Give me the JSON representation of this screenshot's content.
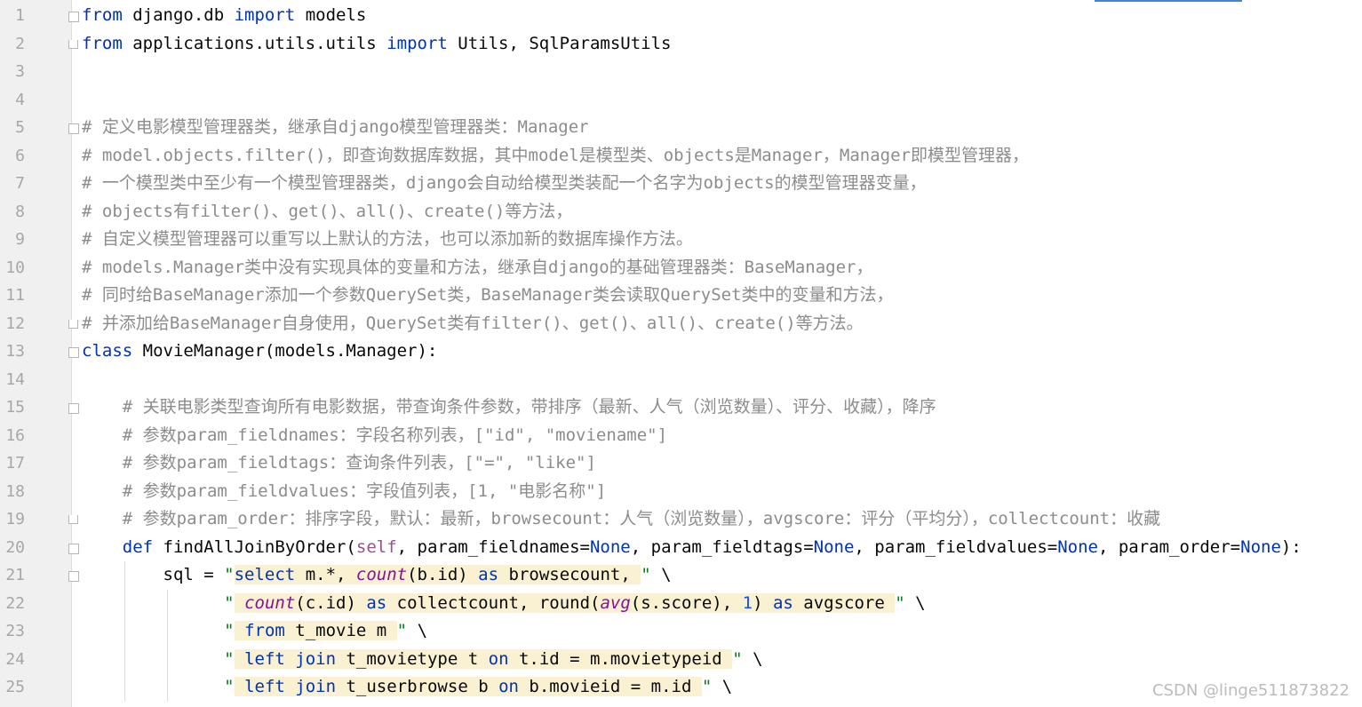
{
  "editor": {
    "lines": [
      {
        "n": "1",
        "t": "from django.db import models"
      },
      {
        "n": "2",
        "t": "from applications.utils.utils import Utils, SqlParamsUtils"
      },
      {
        "n": "3",
        "t": ""
      },
      {
        "n": "4",
        "t": ""
      },
      {
        "n": "5",
        "t": "# 定义电影模型管理器类，继承自django模型管理器类：Manager"
      },
      {
        "n": "6",
        "t": "# model.objects.filter()，即查询数据库数据，其中model是模型类、objects是Manager，Manager即模型管理器，"
      },
      {
        "n": "7",
        "t": "# 一个模型类中至少有一个模型管理器类，django会自动给模型类装配一个名字为objects的模型管理器变量，"
      },
      {
        "n": "8",
        "t": "# objects有filter()、get()、all()、create()等方法，"
      },
      {
        "n": "9",
        "t": "# 自定义模型管理器可以重写以上默认的方法，也可以添加新的数据库操作方法。"
      },
      {
        "n": "10",
        "t": "# models.Manager类中没有实现具体的变量和方法，继承自django的基础管理器类：BaseManager，"
      },
      {
        "n": "11",
        "t": "# 同时给BaseManager添加一个参数QuerySet类，BaseManager类会读取QuerySet类中的变量和方法，"
      },
      {
        "n": "12",
        "t": "# 并添加给BaseManager自身使用，QuerySet类有filter()、get()、all()、create()等方法。"
      },
      {
        "n": "13",
        "t": "class MovieManager(models.Manager):"
      },
      {
        "n": "14",
        "t": ""
      },
      {
        "n": "15",
        "t": "    # 关联电影类型查询所有电影数据，带查询条件参数，带排序（最新、人气（浏览数量）、评分、收藏），降序"
      },
      {
        "n": "16",
        "t": "    # 参数param_fieldnames：字段名称列表，[\"id\", \"moviename\"]"
      },
      {
        "n": "17",
        "t": "    # 参数param_fieldtags：查询条件列表，[\"=\", \"like\"]"
      },
      {
        "n": "18",
        "t": "    # 参数param_fieldvalues：字段值列表，[1, \"电影名称\"]"
      },
      {
        "n": "19",
        "t": "    # 参数param_order：排序字段，默认：最新，browsecount：人气（浏览数量），avgscore：评分（平均分），collectcount：收藏"
      },
      {
        "n": "20",
        "t": "    def findAllJoinByOrder(self, param_fieldnames=None, param_fieldtags=None, param_fieldvalues=None, param_order=None):"
      },
      {
        "n": "21",
        "t": "        sql = \"select m.*, count(b.id) as browsecount, \" \\"
      },
      {
        "n": "22",
        "t": "              \" count(c.id) as collectcount, round(avg(s.score), 1) as avgscore \" \\"
      },
      {
        "n": "23",
        "t": "              \" from t_movie m \" \\"
      },
      {
        "n": "24",
        "t": "              \" left join t_movietype t on t.id = m.movietypeid \" \\"
      },
      {
        "n": "25",
        "t": "              \" left join t_userbrowse b on b.movieid = m.id \" \\"
      }
    ]
  },
  "watermark": "CSDN @linge511873822"
}
